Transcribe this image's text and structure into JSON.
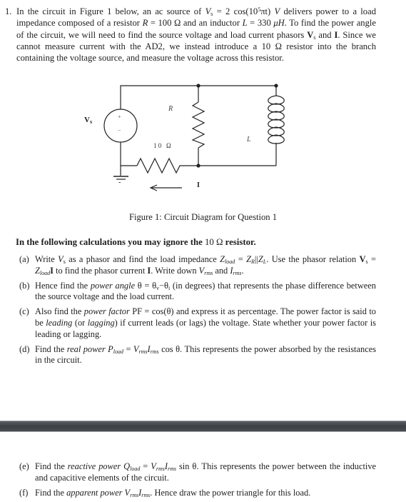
{
  "question": {
    "number": "1.",
    "intro_parts": {
      "a": "In the circuit in Figure 1 below, an ac source of ",
      "vs_sym": "V",
      "vs_sub": "s",
      "eq1": " = 2 cos(10",
      "exp": "5",
      "eq2": "πt) ",
      "unit_v": "V",
      "b": " delivers power to a load impedance composed of a resistor ",
      "r_sym": "R",
      "r_val": " = 100 Ω and an inductor ",
      "l_sym": "L",
      "l_val": " =  330 ",
      "l_unit": "μH",
      "c": ". To find the power angle of the circuit, we will need to find the source voltage and load current phasors ",
      "phasor_v": "V",
      "phasor_v_sub": "s",
      "and": " and ",
      "phasor_i": "I",
      "d": ". Since we cannot measure current with the AD2, we instead introduce a 10 Ω resistor into the branch containing the voltage source, and measure the voltage across this resistor."
    }
  },
  "figure": {
    "labels": {
      "source": "V",
      "source_sub": "s",
      "plus": "+",
      "minus": "−",
      "resistor": "R",
      "inductor": "L",
      "sense_resistor": "1 0   Ω",
      "current": "I",
      "ground_minus": "-"
    },
    "caption": "Figure 1: Circuit Diagram for Question 1"
  },
  "note": {
    "text": "In the following calculations you may ignore the ",
    "value": "10 Ω",
    "tail": " resistor."
  },
  "parts": [
    {
      "label": "(a)"
    },
    {
      "label": "(b)"
    },
    {
      "label": "(c)"
    },
    {
      "label": "(d)"
    },
    {
      "label": "(e)"
    },
    {
      "label": "(f)"
    }
  ],
  "part_text": {
    "a1": "Write ",
    "a_vs": "V",
    "a_s": "s",
    "a2": " as a phasor and find the load impedance ",
    "a_z": "Z",
    "a_load": "load",
    "a3": " = ",
    "a_zr": "Z",
    "a_r": "R",
    "a4": "||",
    "a_zl": "Z",
    "a_l": "L",
    "a5": ". Use the phasor relation ",
    "a_bv": "V",
    "a_bs": "s",
    "a6": " = ",
    "a_z2": "Z",
    "a_load2": "load",
    "a_bi": "I",
    "a7": " to find the phasor current ",
    "a_bi2": "I",
    "a8": ". Write down ",
    "a_v": "V",
    "a_rms": "rms",
    "a9": " and ",
    "a_i": "I",
    "a_rms2": "rms",
    "a10": ".",
    "b1": "Hence find the ",
    "b_em": "power angle",
    "b2": " θ = θ",
    "b_v": "v",
    "b3": "−θ",
    "b_i": "i",
    "b4": " (in degrees) that represents the phase difference between the source voltage and the load current.",
    "c1": "Also find the ",
    "c_em": "power factor",
    "c2": " PF = cos(θ) and express it as percentage. The power factor is said to be ",
    "c_lead": "leading",
    "c3": " (or ",
    "c_lag": "lagging",
    "c4": ") if current leads (or lags) the voltage. State whether your power factor is leading or lagging.",
    "d1": "Find the ",
    "d_em": "real power",
    "d_p": " P",
    "d_load": "load",
    "d2": " = ",
    "d_v": "V",
    "d_rms": "rms",
    "d_i": "I",
    "d_rms2": "rms",
    "d3": " cos θ. This represents the power absorbed by the resistances in the circuit.",
    "e1": "Find the ",
    "e_em": "reactive power",
    "e_q": " Q",
    "e_load": "load",
    "e2": " = ",
    "e_v": "V",
    "e_rms": "rms",
    "e_i": "I",
    "e_rms2": "rms",
    "e3": " sin θ. This represents the power between the inductive and capacitive elements of the circuit.",
    "f1": "Find the ",
    "f_em": "apparent power",
    "f_v": " V",
    "f_rms": "rms",
    "f_i": "I",
    "f_rms2": "rms",
    "f2": ". Hence draw the power triangle for this load."
  }
}
